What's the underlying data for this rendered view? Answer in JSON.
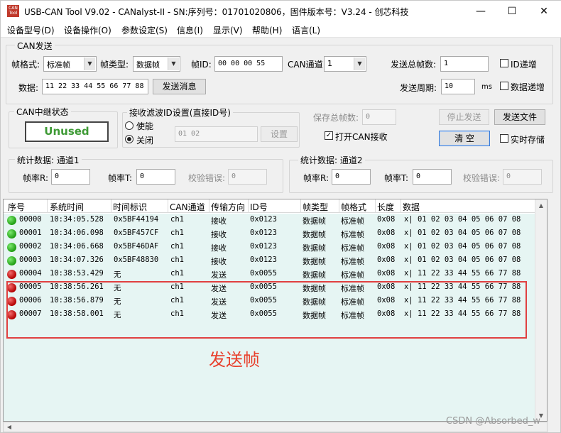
{
  "window": {
    "title": "USB-CAN Tool V9.02 - CANalyst-II - SN:序列号：01701020806，固件版本号：V3.24 - 创芯科技",
    "icon_text": "CAN Tool",
    "minimize": "—",
    "maximize": "☐",
    "close": "✕"
  },
  "menu": [
    "设备型号(D)",
    "设备操作(O)",
    "参数设定(S)",
    "信息(I)",
    "显示(V)",
    "帮助(H)",
    "语言(L)"
  ],
  "can_send": {
    "group_label": "CAN发送",
    "frame_format_label": "帧格式:",
    "frame_format_value": "标准帧",
    "frame_type_label": "帧类型:",
    "frame_type_value": "数据帧",
    "frame_id_label": "帧ID:",
    "frame_id_value": "00 00 00 55",
    "channel_label": "CAN通道:",
    "channel_value": "1",
    "total_frames_label": "发送总帧数:",
    "total_frames_value": "1",
    "id_increment_label": "ID递增",
    "id_increment_checked": false,
    "data_label": "数据:",
    "data_value": "11 22 33 44 55 66 77 88",
    "send_button": "发送消息",
    "period_label": "发送周期:",
    "period_value": "10",
    "period_unit": "ms",
    "data_increment_label": "数据递增",
    "data_increment_checked": false
  },
  "relay": {
    "label": "CAN中继状态",
    "status": "Unused"
  },
  "filter": {
    "label": "接收滤波ID设置(直接ID号)",
    "enable_label": "使能",
    "disable_label": "关闭",
    "selected": "关闭",
    "value": "01 02",
    "set_button": "设置"
  },
  "controls": {
    "save_total_label": "保存总帧数:",
    "save_total_value": "0",
    "stop_send": "停止发送",
    "send_file": "发送文件",
    "open_receive_label": "打开CAN接收",
    "open_receive_checked": true,
    "clear": "清 空",
    "realtime_save_label": "实时存储",
    "realtime_save_checked": false
  },
  "stats1": {
    "label": "统计数据: 通道1",
    "rx_rate_label": "帧率R:",
    "rx_rate": "0",
    "tx_rate_label": "帧率T:",
    "tx_rate": "0",
    "err_label": "校验错误:",
    "err": "0"
  },
  "stats2": {
    "label": "统计数据: 通道2",
    "rx_rate_label": "帧率R:",
    "rx_rate": "0",
    "tx_rate_label": "帧率T:",
    "tx_rate": "0",
    "err_label": "校验错误:",
    "err": "0"
  },
  "table": {
    "columns": [
      "序号",
      "系统时间",
      "时间标识",
      "CAN通道",
      "传输方向",
      "ID号",
      "帧类型",
      "帧格式",
      "长度",
      "数据"
    ],
    "rows": [
      {
        "status": "green",
        "seq": "00000",
        "time": "10:34:05.528",
        "stamp": "0x5BF44194",
        "ch": "ch1",
        "dir": "接收",
        "id": "0x0123",
        "type": "数据帧",
        "format": "标准帧",
        "len": "0x08",
        "data": "x| 01 02 03 04 05 06 07 08"
      },
      {
        "status": "green",
        "seq": "00001",
        "time": "10:34:06.098",
        "stamp": "0x5BF457CF",
        "ch": "ch1",
        "dir": "接收",
        "id": "0x0123",
        "type": "数据帧",
        "format": "标准帧",
        "len": "0x08",
        "data": "x| 01 02 03 04 05 06 07 08"
      },
      {
        "status": "green",
        "seq": "00002",
        "time": "10:34:06.668",
        "stamp": "0x5BF46DAF",
        "ch": "ch1",
        "dir": "接收",
        "id": "0x0123",
        "type": "数据帧",
        "format": "标准帧",
        "len": "0x08",
        "data": "x| 01 02 03 04 05 06 07 08"
      },
      {
        "status": "green",
        "seq": "00003",
        "time": "10:34:07.326",
        "stamp": "0x5BF48830",
        "ch": "ch1",
        "dir": "接收",
        "id": "0x0123",
        "type": "数据帧",
        "format": "标准帧",
        "len": "0x08",
        "data": "x| 01 02 03 04 05 06 07 08"
      },
      {
        "status": "red",
        "seq": "00004",
        "time": "10:38:53.429",
        "stamp": "无",
        "ch": "ch1",
        "dir": "发送",
        "id": "0x0055",
        "type": "数据帧",
        "format": "标准帧",
        "len": "0x08",
        "data": "x| 11 22 33 44 55 66 77 88"
      },
      {
        "status": "red",
        "seq": "00005",
        "time": "10:38:56.261",
        "stamp": "无",
        "ch": "ch1",
        "dir": "发送",
        "id": "0x0055",
        "type": "数据帧",
        "format": "标准帧",
        "len": "0x08",
        "data": "x| 11 22 33 44 55 66 77 88"
      },
      {
        "status": "red",
        "seq": "00006",
        "time": "10:38:56.879",
        "stamp": "无",
        "ch": "ch1",
        "dir": "发送",
        "id": "0x0055",
        "type": "数据帧",
        "format": "标准帧",
        "len": "0x08",
        "data": "x| 11 22 33 44 55 66 77 88"
      },
      {
        "status": "red",
        "seq": "00007",
        "time": "10:38:58.001",
        "stamp": "无",
        "ch": "ch1",
        "dir": "发送",
        "id": "0x0055",
        "type": "数据帧",
        "format": "标准帧",
        "len": "0x08",
        "data": "x| 11 22 33 44 55 66 77 88"
      }
    ]
  },
  "annotation": "发送帧",
  "watermark": "CSDN @Absorbed_w",
  "colors": {
    "table_bg": "#e6f5f3",
    "annotation": "#e8402c",
    "relay_text": "#3e9a35"
  }
}
